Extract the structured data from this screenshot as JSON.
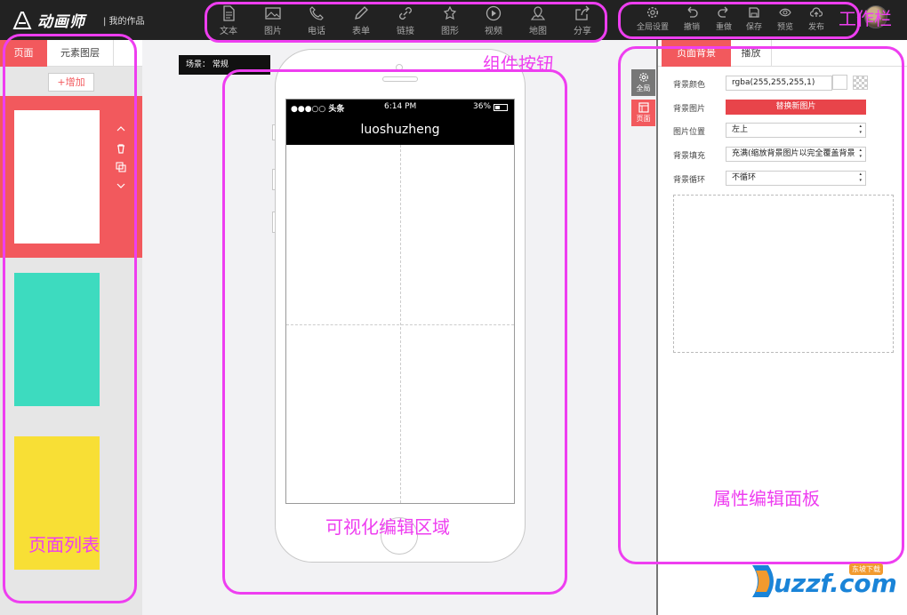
{
  "topbar": {
    "logo_text": "动画师",
    "my_works": "| 我的作品",
    "tools": [
      {
        "label": "文本",
        "icon": "document-icon"
      },
      {
        "label": "图片",
        "icon": "image-icon"
      },
      {
        "label": "电话",
        "icon": "phone-icon"
      },
      {
        "label": "表单",
        "icon": "pencil-icon"
      },
      {
        "label": "链接",
        "icon": "link-icon"
      },
      {
        "label": "图形",
        "icon": "shape-icon"
      },
      {
        "label": "视频",
        "icon": "play-icon"
      },
      {
        "label": "地图",
        "icon": "map-pin-icon"
      },
      {
        "label": "分享",
        "icon": "share-icon"
      }
    ],
    "actions": [
      {
        "label": "全局设置",
        "icon": "gear-icon"
      },
      {
        "label": "撤销",
        "icon": "undo-icon"
      },
      {
        "label": "重做",
        "icon": "redo-icon"
      },
      {
        "label": "保存",
        "icon": "save-icon"
      },
      {
        "label": "预览",
        "icon": "eye-icon"
      },
      {
        "label": "发布",
        "icon": "upload-cloud-icon"
      }
    ]
  },
  "left_panel": {
    "tab_pages": "页面",
    "tab_layers": "元素图层",
    "add_button": "+增加",
    "page_colors": [
      "#ffffff",
      "#3ddbbf",
      "#f8df35"
    ]
  },
  "canvas": {
    "scene_label": "场景： 常规",
    "status_left": "●●●○○ 头条",
    "status_time": "6:14 PM",
    "status_battery": "36%",
    "page_title": "luoshuzheng"
  },
  "right_panel": {
    "tab_background": "页面背景",
    "tab_play": "播放",
    "side_global": "全局",
    "side_page": "页面",
    "bg_color_label": "背景颜色",
    "bg_color_value": "rgba(255,255,255,1)",
    "bg_image_label": "背景图片",
    "replace_image_button": "替换新图片",
    "image_position_label": "图片位置",
    "image_position_value": "左上",
    "bg_fill_label": "背景填充",
    "bg_fill_value": "充满(缩放背景图片以完全覆盖背景",
    "bg_repeat_label": "背景循环",
    "bg_repeat_value": "不循环"
  },
  "annotations": {
    "toolbar": "工作栏",
    "components": "组件按钮",
    "page_list": "页面列表",
    "visual_edit": "可视化编辑区域",
    "property_panel": "属性编辑面板"
  },
  "watermark": {
    "text": "uzzf.com",
    "badge": "东坡下载"
  },
  "colors": {
    "accent": "#f2595d",
    "annotation": "#ee3ef0",
    "topbar": "#222222"
  }
}
